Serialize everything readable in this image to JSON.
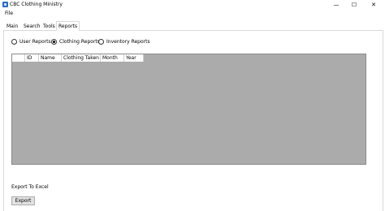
{
  "window": {
    "title": "CBC Clothing Ministry",
    "minimize_glyph": "—",
    "maximize_glyph": "☐",
    "close_glyph": "✕"
  },
  "menu": {
    "file": "File"
  },
  "tabs": [
    {
      "label": "Main"
    },
    {
      "label": "Search"
    },
    {
      "label": "Tools"
    },
    {
      "label": "Reports",
      "active": true
    }
  ],
  "report_options": [
    {
      "label": "User Reports",
      "checked": false
    },
    {
      "label": "Clothing Reports",
      "checked": true
    },
    {
      "label": "Inventory Reports",
      "checked": false
    }
  ],
  "grid": {
    "columns": [
      "ID",
      "Name",
      "Clothing Taken",
      "Month",
      "Year"
    ],
    "rows": []
  },
  "export": {
    "label": "Export To Excel",
    "button": "Export"
  },
  "colors": {
    "grid_background": "#ababab",
    "app_icon": "#2b6cc4"
  },
  "icons": [
    "app-icon",
    "minimize-icon",
    "maximize-icon",
    "close-icon"
  ]
}
